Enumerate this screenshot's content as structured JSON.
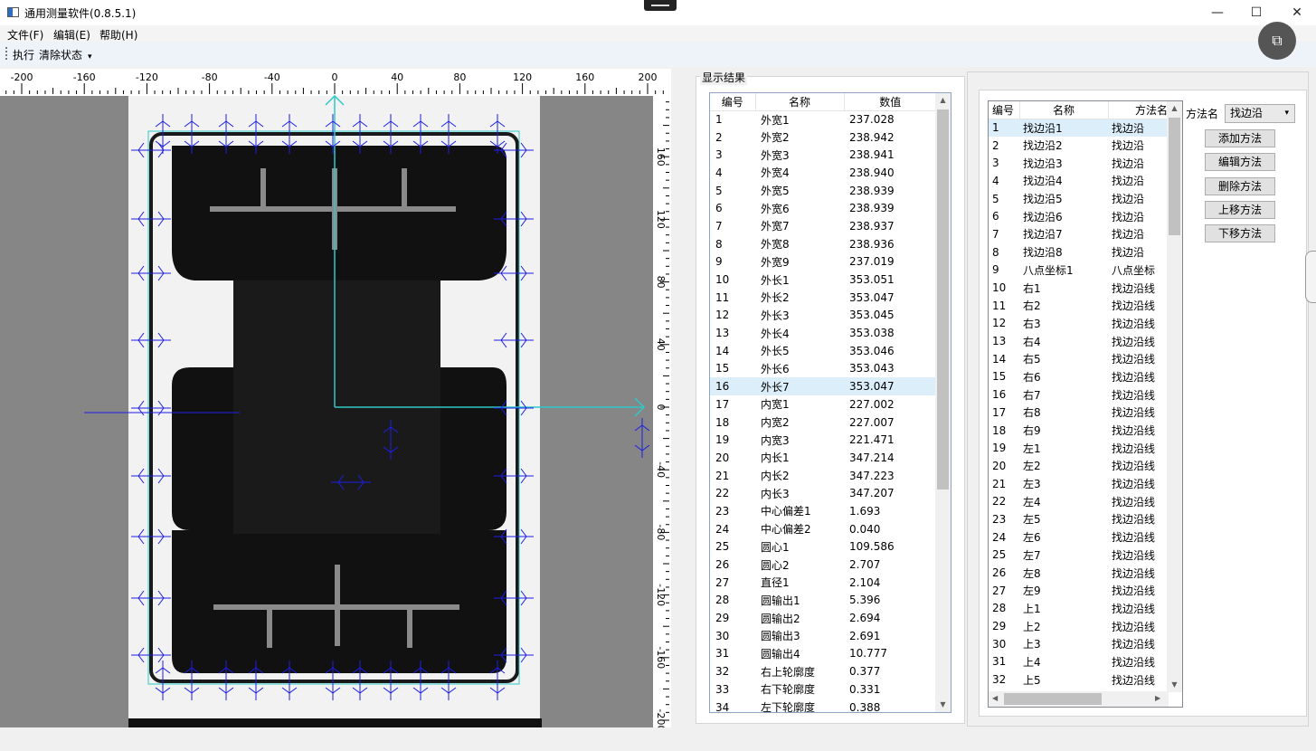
{
  "window": {
    "title": "通用测量软件(0.8.5.1)",
    "minimize": "—",
    "maximize": "☐",
    "close": "✕"
  },
  "menu": {
    "file": "文件(F)",
    "edit": "编辑(E)",
    "help": "帮助(H)"
  },
  "toolbar": {
    "run": "执行",
    "clear": "清除状态",
    "more": "▾"
  },
  "snap_icon": "screenshot-tool-icon",
  "ruler": {
    "top_ticks": [
      "-200",
      "-160",
      "-120",
      "-80",
      "-40",
      "0",
      "40",
      "80",
      "120",
      "160",
      "200"
    ],
    "right_ticks": [
      "160",
      "120",
      "80",
      "40",
      "0",
      "-40",
      "-80",
      "-120",
      "-160",
      "-200"
    ]
  },
  "results": {
    "group_title": "显示结果",
    "headers": [
      "编号",
      "名称",
      "数值"
    ],
    "selected_row": 16,
    "rows": [
      [
        "1",
        "外宽1",
        "237.028"
      ],
      [
        "2",
        "外宽2",
        "238.942"
      ],
      [
        "3",
        "外宽3",
        "238.941"
      ],
      [
        "4",
        "外宽4",
        "238.940"
      ],
      [
        "5",
        "外宽5",
        "238.939"
      ],
      [
        "6",
        "外宽6",
        "238.939"
      ],
      [
        "7",
        "外宽7",
        "238.937"
      ],
      [
        "8",
        "外宽8",
        "238.936"
      ],
      [
        "9",
        "外宽9",
        "237.019"
      ],
      [
        "10",
        "外长1",
        "353.051"
      ],
      [
        "11",
        "外长2",
        "353.047"
      ],
      [
        "12",
        "外长3",
        "353.045"
      ],
      [
        "13",
        "外长4",
        "353.038"
      ],
      [
        "14",
        "外长5",
        "353.046"
      ],
      [
        "15",
        "外长6",
        "353.043"
      ],
      [
        "16",
        "外长7",
        "353.047"
      ],
      [
        "17",
        "内宽1",
        "227.002"
      ],
      [
        "18",
        "内宽2",
        "227.007"
      ],
      [
        "19",
        "内宽3",
        "221.471"
      ],
      [
        "20",
        "内长1",
        "347.214"
      ],
      [
        "21",
        "内长2",
        "347.223"
      ],
      [
        "22",
        "内长3",
        "347.207"
      ],
      [
        "23",
        "中心偏差1",
        "1.693"
      ],
      [
        "24",
        "中心偏差2",
        "0.040"
      ],
      [
        "25",
        "圆心1",
        "109.586"
      ],
      [
        "26",
        "圆心2",
        "2.707"
      ],
      [
        "27",
        "直径1",
        "2.104"
      ],
      [
        "28",
        "圆输出1",
        "5.396"
      ],
      [
        "29",
        "圆输出2",
        "2.694"
      ],
      [
        "30",
        "圆输出3",
        "2.691"
      ],
      [
        "31",
        "圆输出4",
        "10.777"
      ],
      [
        "32",
        "右上轮廓度",
        "0.377"
      ],
      [
        "33",
        "右下轮廓度",
        "0.331"
      ],
      [
        "34",
        "左下轮廓度",
        "0.388"
      ]
    ]
  },
  "methods": {
    "headers": [
      "编号",
      "名称",
      "方法名"
    ],
    "selected_row": 1,
    "rows": [
      [
        "1",
        "找边沿1",
        "找边沿"
      ],
      [
        "2",
        "找边沿2",
        "找边沿"
      ],
      [
        "3",
        "找边沿3",
        "找边沿"
      ],
      [
        "4",
        "找边沿4",
        "找边沿"
      ],
      [
        "5",
        "找边沿5",
        "找边沿"
      ],
      [
        "6",
        "找边沿6",
        "找边沿"
      ],
      [
        "7",
        "找边沿7",
        "找边沿"
      ],
      [
        "8",
        "找边沿8",
        "找边沿"
      ],
      [
        "9",
        "八点坐标1",
        "八点坐标"
      ],
      [
        "10",
        "右1",
        "找边沿线"
      ],
      [
        "11",
        "右2",
        "找边沿线"
      ],
      [
        "12",
        "右3",
        "找边沿线"
      ],
      [
        "13",
        "右4",
        "找边沿线"
      ],
      [
        "14",
        "右5",
        "找边沿线"
      ],
      [
        "15",
        "右6",
        "找边沿线"
      ],
      [
        "16",
        "右7",
        "找边沿线"
      ],
      [
        "17",
        "右8",
        "找边沿线"
      ],
      [
        "18",
        "右9",
        "找边沿线"
      ],
      [
        "19",
        "左1",
        "找边沿线"
      ],
      [
        "20",
        "左2",
        "找边沿线"
      ],
      [
        "21",
        "左3",
        "找边沿线"
      ],
      [
        "22",
        "左4",
        "找边沿线"
      ],
      [
        "23",
        "左5",
        "找边沿线"
      ],
      [
        "24",
        "左6",
        "找边沿线"
      ],
      [
        "25",
        "左7",
        "找边沿线"
      ],
      [
        "26",
        "左8",
        "找边沿线"
      ],
      [
        "27",
        "左9",
        "找边沿线"
      ],
      [
        "28",
        "上1",
        "找边沿线"
      ],
      [
        "29",
        "上2",
        "找边沿线"
      ],
      [
        "30",
        "上3",
        "找边沿线"
      ],
      [
        "31",
        "上4",
        "找边沿线"
      ],
      [
        "32",
        "上5",
        "找边沿线"
      ]
    ],
    "method_name_label": "方法名",
    "method_name_value": "找边沿",
    "buttons": {
      "add": "添加方法",
      "edit": "编辑方法",
      "delete": "删除方法",
      "up": "上移方法",
      "down": "下移方法"
    }
  },
  "colors": {
    "accent": "#2b6fc4",
    "selection": "#dbeefa",
    "marker": "#1e1ee6",
    "axis": "#2fc8c8"
  }
}
